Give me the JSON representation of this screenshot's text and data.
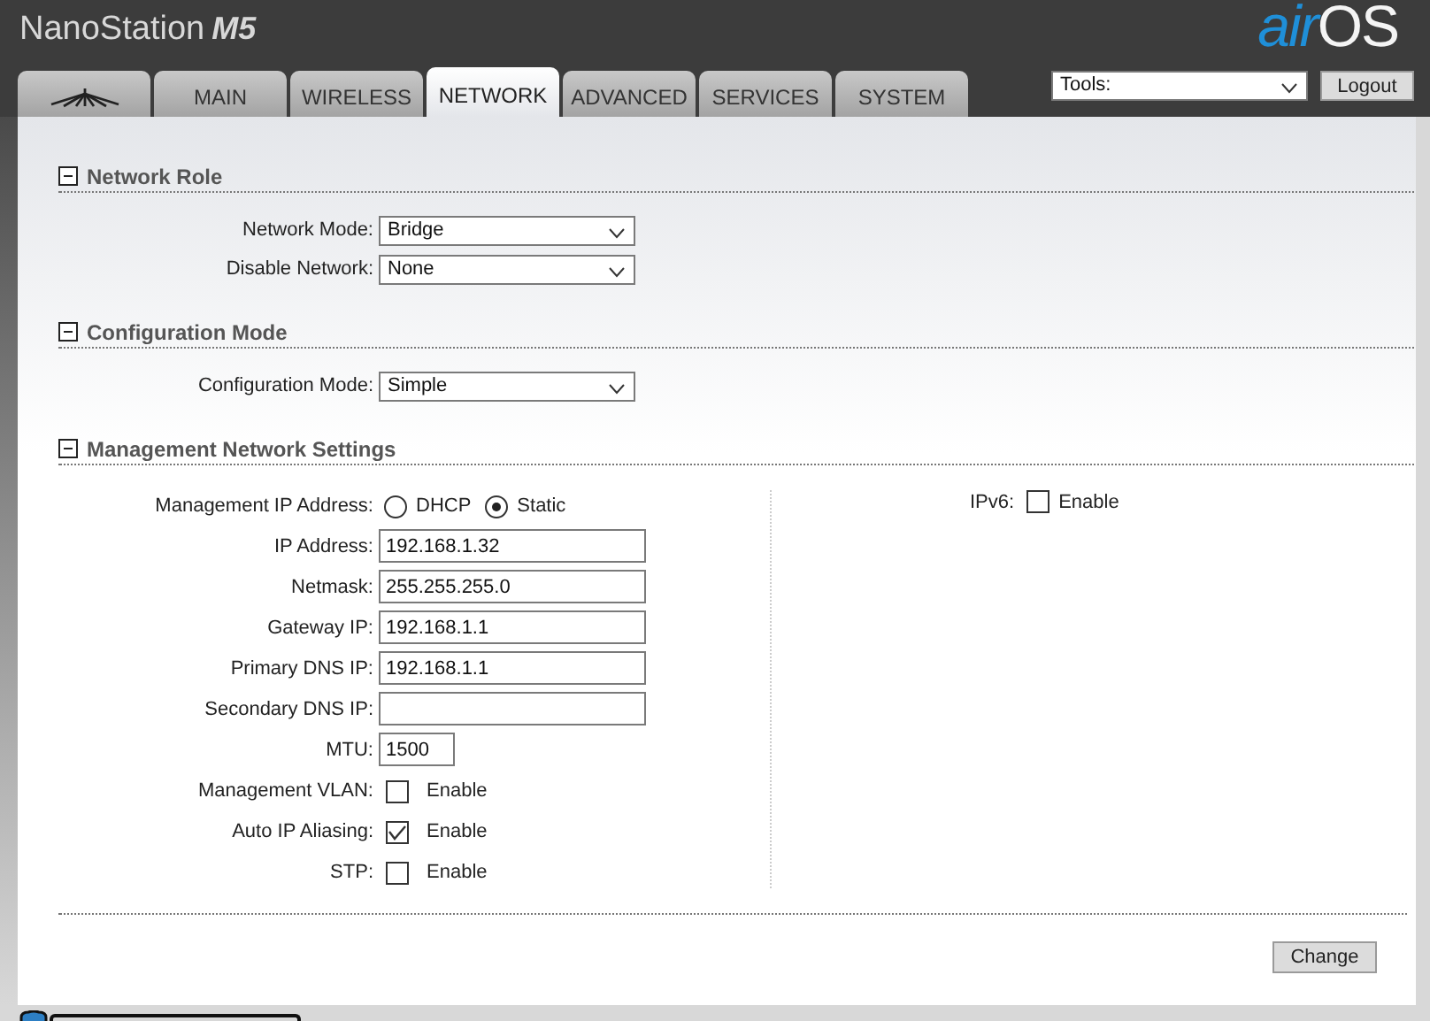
{
  "header": {
    "product": "NanoStation",
    "model": "M5",
    "brand_prefix": "air",
    "brand_suffix": "OS"
  },
  "tabs": [
    {
      "kind": "logo",
      "selected": false
    },
    {
      "kind": "text",
      "label": "MAIN",
      "selected": false
    },
    {
      "kind": "text",
      "label": "WIRELESS",
      "selected": false
    },
    {
      "kind": "text",
      "label": "NETWORK",
      "selected": true
    },
    {
      "kind": "text",
      "label": "ADVANCED",
      "selected": false
    },
    {
      "kind": "text",
      "label": "SERVICES",
      "selected": false
    },
    {
      "kind": "text",
      "label": "SYSTEM",
      "selected": false
    }
  ],
  "tools": {
    "value": "Tools:"
  },
  "logout_button": "Logout",
  "sections": [
    {
      "title": "Network Role",
      "expanded": true,
      "rows": [
        {
          "kind": "select",
          "label": "Network Mode:",
          "value": "Bridge"
        },
        {
          "kind": "select",
          "label": "Disable Network:",
          "value": "None"
        }
      ]
    },
    {
      "title": "Configuration Mode",
      "expanded": true,
      "rows": [
        {
          "kind": "select",
          "label": "Configuration Mode:",
          "value": "Simple"
        }
      ]
    },
    {
      "title": "Management Network Settings",
      "expanded": true,
      "rows": [
        {
          "kind": "radio",
          "label": "Management IP Address:",
          "options": [
            {
              "label": "DHCP",
              "selected": false
            },
            {
              "label": "Static",
              "selected": true
            }
          ]
        },
        {
          "kind": "text",
          "label": "IP Address:",
          "value": "192.168.1.32"
        },
        {
          "kind": "text",
          "label": "Netmask:",
          "value": "255.255.255.0"
        },
        {
          "kind": "text",
          "label": "Gateway IP:",
          "value": "192.168.1.1"
        },
        {
          "kind": "text",
          "label": "Primary DNS IP:",
          "value": "192.168.1.1"
        },
        {
          "kind": "text",
          "label": "Secondary DNS IP:"
        },
        {
          "kind": "short",
          "label": "MTU:",
          "value": "1500"
        },
        {
          "kind": "checkbox",
          "label": "Management VLAN:",
          "option": "Enable",
          "checked": false
        },
        {
          "kind": "checkbox",
          "label": "Auto IP Aliasing:",
          "option": "Enable",
          "checked": true
        },
        {
          "kind": "checkbox",
          "label": "STP:",
          "option": "Enable",
          "checked": false
        }
      ],
      "right_rows": [
        {
          "kind": "checkbox",
          "label": "IPv6:",
          "option": "Enable",
          "checked": false
        }
      ]
    }
  ],
  "change_button": "Change"
}
